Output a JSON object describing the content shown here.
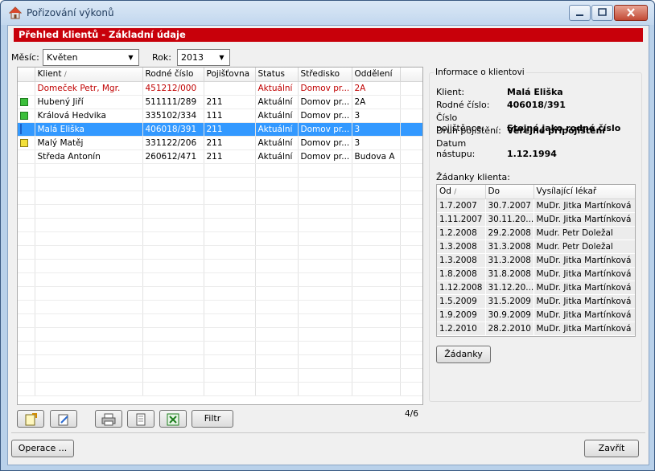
{
  "window": {
    "title": "Pořizování výkonů"
  },
  "header": {
    "title": "Přehled klientů - Základní údaje"
  },
  "filters": {
    "month_label": "Měsíc:",
    "month_value": "Květen",
    "year_label": "Rok:",
    "year_value": "2013"
  },
  "clients_table": {
    "columns": [
      "",
      "Klient",
      "Rodné číslo",
      "Pojišťovna",
      "Status",
      "Středisko",
      "Oddělení"
    ],
    "rows": [
      {
        "marker": "",
        "klient": "Domeček Petr, Mgr.",
        "rc": "451212/000",
        "poj": "",
        "status": "Aktuální",
        "stredisko": "Domov pr...",
        "oddeleni": "2A"
      },
      {
        "marker": "green",
        "klient": "Hubený Jiří",
        "rc": "511111/289",
        "poj": "211",
        "status": "Aktuální",
        "stredisko": "Domov pr...",
        "oddeleni": "2A"
      },
      {
        "marker": "green",
        "klient": "Králová Hedvika",
        "rc": "335102/334",
        "poj": "111",
        "status": "Aktuální",
        "stredisko": "Domov pr...",
        "oddeleni": "3"
      },
      {
        "marker": "blue",
        "klient": "Malá Eliška",
        "rc": "406018/391",
        "poj": "211",
        "status": "Aktuální",
        "stredisko": "Domov pr...",
        "oddeleni": "3"
      },
      {
        "marker": "yellow",
        "klient": "Malý Matěj",
        "rc": "331122/206",
        "poj": "211",
        "status": "Aktuální",
        "stredisko": "Domov pr...",
        "oddeleni": "3"
      },
      {
        "marker": "",
        "klient": "Středa Antonín",
        "rc": "260612/471",
        "poj": "211",
        "status": "Aktuální",
        "stredisko": "Domov pr...",
        "oddeleni": "Budova A"
      }
    ],
    "counter": "4/6"
  },
  "info": {
    "group_title": "Informace o klientovi",
    "klient_label": "Klient:",
    "klient_value": "Malá Eliška",
    "rc_label": "Rodné číslo:",
    "rc_value": "406018/391",
    "cp_label": "Číslo pojištěnce:",
    "cp_value": "Stejné jako rodné číslo",
    "druh_label": "Druh pojištění:",
    "druh_value": "Veřejné připojištění",
    "datum_label": "Datum nástupu:",
    "datum_value": "1.12.1994"
  },
  "requests": {
    "label": "Žádanky klienta:",
    "columns": [
      "Od",
      "Do",
      "Vysílající lékař"
    ],
    "rows": [
      {
        "od": "1.7.2007",
        "do": "30.7.2007",
        "lekar": "MuDr. Jitka Martínková"
      },
      {
        "od": "1.11.2007",
        "do": "30.11.20...",
        "lekar": "MuDr. Jitka Martínková"
      },
      {
        "od": "1.2.2008",
        "do": "29.2.2008",
        "lekar": "Mudr. Petr Doležal"
      },
      {
        "od": "1.3.2008",
        "do": "31.3.2008",
        "lekar": "Mudr. Petr Doležal"
      },
      {
        "od": "1.3.2008",
        "do": "31.3.2008",
        "lekar": "MuDr. Jitka Martínková"
      },
      {
        "od": "1.8.2008",
        "do": "31.8.2008",
        "lekar": "MuDr. Jitka Martínková"
      },
      {
        "od": "1.12.2008",
        "do": "31.12.20...",
        "lekar": "MuDr. Jitka Martínková"
      },
      {
        "od": "1.5.2009",
        "do": "31.5.2009",
        "lekar": "MuDr. Jitka Martínková"
      },
      {
        "od": "1.9.2009",
        "do": "30.9.2009",
        "lekar": "MuDr. Jitka Martínková"
      },
      {
        "od": "1.2.2010",
        "do": "28.2.2010",
        "lekar": "MuDr. Jitka Martínková"
      }
    ],
    "button_label": "Žádanky"
  },
  "toolbar": {
    "filter_label": "Filtr",
    "icons": [
      "new-record-icon",
      "edit-record-icon",
      "print-icon",
      "document-icon",
      "excel-export-icon"
    ]
  },
  "footer": {
    "operace_label": "Operace ...",
    "close_label": "Zavřít"
  },
  "colors": {
    "header_red": "#c8000a",
    "selection_blue": "#3399ff",
    "red_text": "#c00000"
  }
}
